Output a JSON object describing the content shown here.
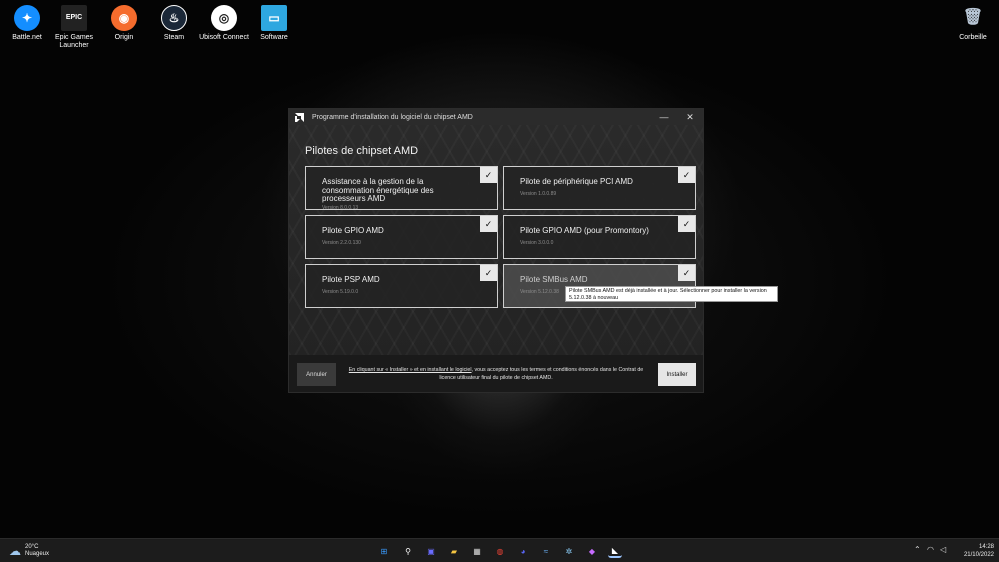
{
  "desktop": {
    "icons": [
      {
        "label": "Battle.net",
        "glyph": "✦",
        "color": "#148eff"
      },
      {
        "label": "Epic Games Launcher",
        "glyph": "EPIC",
        "color": "#222222"
      },
      {
        "label": "Origin",
        "glyph": "◉",
        "color": "#f56c2d"
      },
      {
        "label": "Steam",
        "glyph": "♨",
        "color": "#1b2838"
      },
      {
        "label": "Ubisoft Connect",
        "glyph": "◎",
        "color": "#ffffff"
      },
      {
        "label": "Software",
        "glyph": "▭",
        "color": "#2ea7e0"
      },
      {
        "label": "Corbeille",
        "glyph": "🗑",
        "color": "#b9c7d6"
      }
    ]
  },
  "window": {
    "title": "Programme d'installation du logiciel du chipset AMD",
    "minimize_glyph": "—",
    "close_glyph": "✕",
    "heading": "Pilotes de chipset AMD",
    "drivers": [
      {
        "name": "Assistance à la gestion de la consommation énergétique des processeurs AMD",
        "version": "Version 8.0.0.13",
        "checked": true
      },
      {
        "name": "Pilote de périphérique PCI AMD",
        "version": "Version 1.0.0.89",
        "checked": true
      },
      {
        "name": "Pilote GPIO AMD",
        "version": "Version 2.2.0.130",
        "checked": true
      },
      {
        "name": "Pilote GPIO AMD (pour Promontory)",
        "version": "Version 3.0.0.0",
        "checked": true
      },
      {
        "name": "Pilote PSP AMD",
        "version": "Version 5.19.0.0",
        "checked": true
      },
      {
        "name": "Pilote SMBus AMD",
        "version": "Version 5.12.0.38",
        "checked": true
      }
    ],
    "check_glyph": "✓",
    "tooltip": "Pilote SMBus AMD est déjà installée et à jour. Sélectionner pour installer la version 5.12.0.38 à nouveau",
    "footer": {
      "cancel_label": "Annuler",
      "install_label": "Installer",
      "legal_link": "En cliquant sur « Installer » et en installant le logiciel",
      "legal_rest": ", vous acceptez tous les termes et conditions énoncés dans le Contrat de licence utilisateur final du pilote de chipset AMD."
    }
  },
  "taskbar": {
    "weather_temp": "20°C",
    "weather_desc": "Nuageux",
    "apps": [
      {
        "icon": "windows-start-icon",
        "glyph": "⊞",
        "color": "#3a9bff"
      },
      {
        "icon": "search-icon",
        "glyph": "⚲",
        "color": "#ffffff"
      },
      {
        "icon": "chat-icon",
        "glyph": "▣",
        "color": "#6a6cff"
      },
      {
        "icon": "file-explorer-icon",
        "glyph": "▰",
        "color": "#f5c542"
      },
      {
        "icon": "store-icon",
        "glyph": "▦",
        "color": "#d9d9d9"
      },
      {
        "icon": "chrome-icon",
        "glyph": "◍",
        "color": "#e94235"
      },
      {
        "icon": "discord-icon",
        "glyph": "◕",
        "color": "#5865f2"
      },
      {
        "icon": "network-icon",
        "glyph": "≈",
        "color": "#6fb7ff"
      },
      {
        "icon": "fan-icon",
        "glyph": "✲",
        "color": "#8fd3ff"
      },
      {
        "icon": "rgb-icon",
        "glyph": "◆",
        "color": "#c66bff"
      },
      {
        "icon": "amd-installer-icon",
        "glyph": "◣",
        "color": "#ffffff"
      }
    ],
    "time": "14:28",
    "date": "21/10/2022"
  }
}
